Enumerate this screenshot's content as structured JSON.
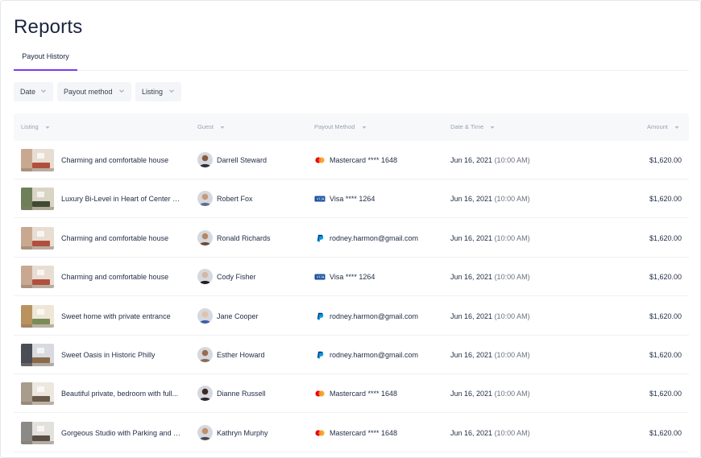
{
  "page": {
    "title": "Reports"
  },
  "tabs": [
    {
      "label": "Payout History",
      "active": true
    }
  ],
  "filters": [
    {
      "label": "Date"
    },
    {
      "label": "Payout method"
    },
    {
      "label": "Listing"
    }
  ],
  "table": {
    "columns": {
      "listing": "Listing",
      "guest": "Guest",
      "payout_method": "Payout Method",
      "date_time": "Date & Time",
      "amount": "Amount"
    },
    "rows": [
      {
        "listing": "Charming and comfortable house",
        "guest": "Darrell Steward",
        "method_icon": "mastercard-icon",
        "method": "Mastercard **** 1648",
        "date": "Jun 16, 2021",
        "time": "(10:00 AM)",
        "amount": "$1,620.00"
      },
      {
        "listing": "Luxury Bi-Level in Heart of Center City",
        "guest": "Robert Fox",
        "method_icon": "visa-icon",
        "method": "Visa **** 1264",
        "date": "Jun 16, 2021",
        "time": "(10:00 AM)",
        "amount": "$1,620.00"
      },
      {
        "listing": "Charming and comfortable house",
        "guest": "Ronald Richards",
        "method_icon": "paypal-icon",
        "method": "rodney.harmon@gmail.com",
        "date": "Jun 16, 2021",
        "time": "(10:00 AM)",
        "amount": "$1,620.00"
      },
      {
        "listing": "Charming and comfortable house",
        "guest": "Cody Fisher",
        "method_icon": "visa-icon",
        "method": "Visa **** 1264",
        "date": "Jun 16, 2021",
        "time": "(10:00 AM)",
        "amount": "$1,620.00"
      },
      {
        "listing": "Sweet home with private entrance",
        "guest": "Jane Cooper",
        "method_icon": "paypal-icon",
        "method": "rodney.harmon@gmail.com",
        "date": "Jun 16, 2021",
        "time": "(10:00 AM)",
        "amount": "$1,620.00"
      },
      {
        "listing": "Sweet Oasis in Historic Philly",
        "guest": "Esther Howard",
        "method_icon": "paypal-icon",
        "method": "rodney.harmon@gmail.com",
        "date": "Jun 16, 2021",
        "time": "(10:00 AM)",
        "amount": "$1,620.00"
      },
      {
        "listing": "Beautiful private, bedroom with full...",
        "guest": "Dianne Russell",
        "method_icon": "mastercard-icon",
        "method": "Mastercard **** 1648",
        "date": "Jun 16, 2021",
        "time": "(10:00 AM)",
        "amount": "$1,620.00"
      },
      {
        "listing": "Gorgeous Studio with Parking and C...",
        "guest": "Kathryn Murphy",
        "method_icon": "mastercard-icon",
        "method": "Mastercard **** 1648",
        "date": "Jun 16, 2021",
        "time": "(10:00 AM)",
        "amount": "$1,620.00"
      }
    ]
  },
  "colors": {
    "accent": "#7c3aed",
    "title": "#1a2540",
    "header_bg": "#f7f8fa",
    "filter_bg": "#f3f5f8",
    "mastercard_red": "#eb001b",
    "mastercard_orange": "#f79e1b",
    "visa_blue": "#1a4fa0",
    "paypal_blue": "#009cde"
  }
}
